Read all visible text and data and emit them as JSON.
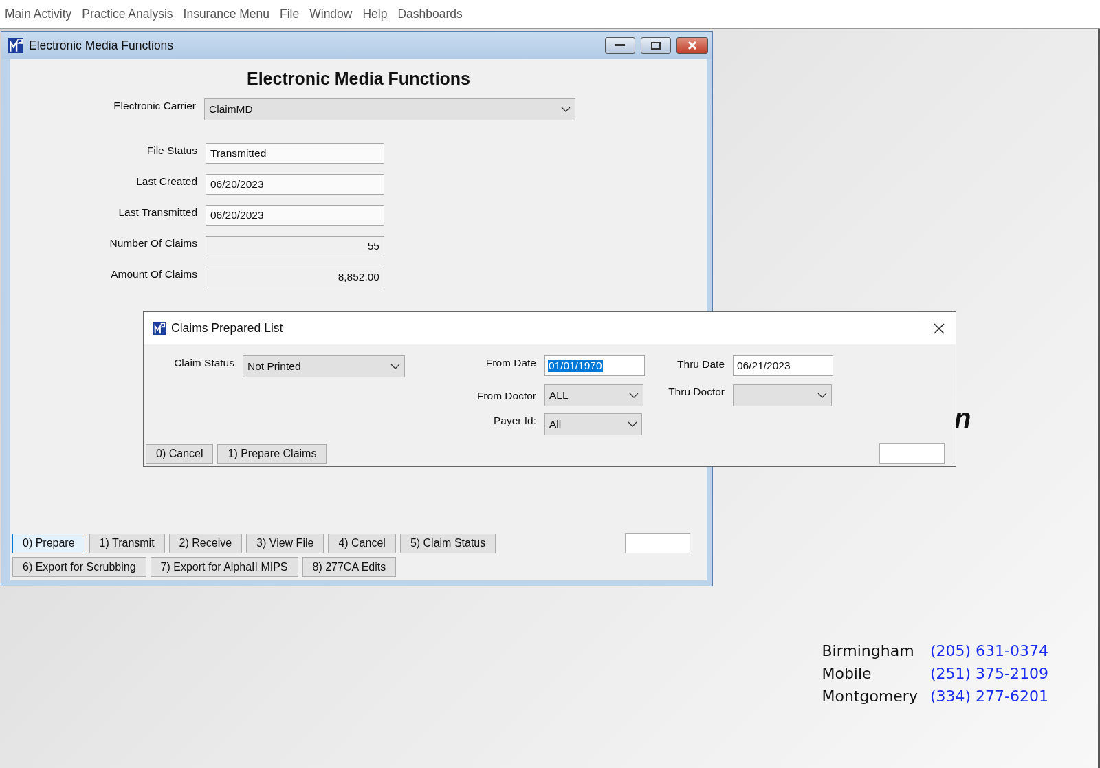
{
  "menu_bar": [
    "Main Activity",
    "Practice Analysis",
    "Insurance Menu",
    "File",
    "Window",
    "Help",
    "Dashboards"
  ],
  "main_window": {
    "title": "Electronic Media Functions",
    "heading": "Electronic Media Functions",
    "carrier": {
      "label": "Electronic Carrier",
      "value": "ClaimMD"
    },
    "fields": [
      {
        "label": "File Status",
        "value": "Transmitted",
        "kind": "text"
      },
      {
        "label": "Last Created",
        "value": "06/20/2023",
        "kind": "text"
      },
      {
        "label": "Last Transmitted",
        "value": "06/20/2023",
        "kind": "text"
      },
      {
        "label": "Number Of Claims",
        "value": "55",
        "kind": "number"
      },
      {
        "label": "Amount Of Claims",
        "value": "8,852.00",
        "kind": "number"
      }
    ],
    "button_rows": [
      [
        {
          "label": "0) Prepare",
          "focused": true
        },
        {
          "label": "1) Transmit",
          "focused": false
        },
        {
          "label": "2) Receive",
          "focused": false
        },
        {
          "label": "3) View File",
          "focused": false
        },
        {
          "label": "4) Cancel",
          "focused": false
        },
        {
          "label": "5) Claim Status",
          "focused": false
        }
      ],
      [
        {
          "label": "6) Export for Scrubbing",
          "focused": false
        },
        {
          "label": "7) Export for AlphaII MIPS",
          "focused": false
        },
        {
          "label": "8) 277CA Edits",
          "focused": false
        }
      ]
    ]
  },
  "background_text": "n",
  "dialog": {
    "title": "Claims Prepared List",
    "claim_status": {
      "label": "Claim Status",
      "value": "Not Printed"
    },
    "from_date": {
      "label": "From Date",
      "value": "01/01/1970",
      "text_selected": true
    },
    "thru_date": {
      "label": "Thru Date",
      "value": "06/21/2023",
      "text_selected": false
    },
    "from_doctor": {
      "label": "From Doctor",
      "value": "ALL"
    },
    "thru_doctor": {
      "label": "Thru Doctor"
    },
    "payer_id": {
      "label": "Payer Id:",
      "value": "All"
    },
    "buttons": [
      {
        "label": "0) Cancel",
        "focused": false
      },
      {
        "label": "1) Prepare Claims",
        "focused": false
      }
    ]
  },
  "contacts": [
    {
      "city": "Birmingham",
      "phone": "(205) 631-0374"
    },
    {
      "city": "Mobile",
      "phone": "(251) 375-2109"
    },
    {
      "city": "Montgomery",
      "phone": "(334) 277-6201"
    }
  ]
}
